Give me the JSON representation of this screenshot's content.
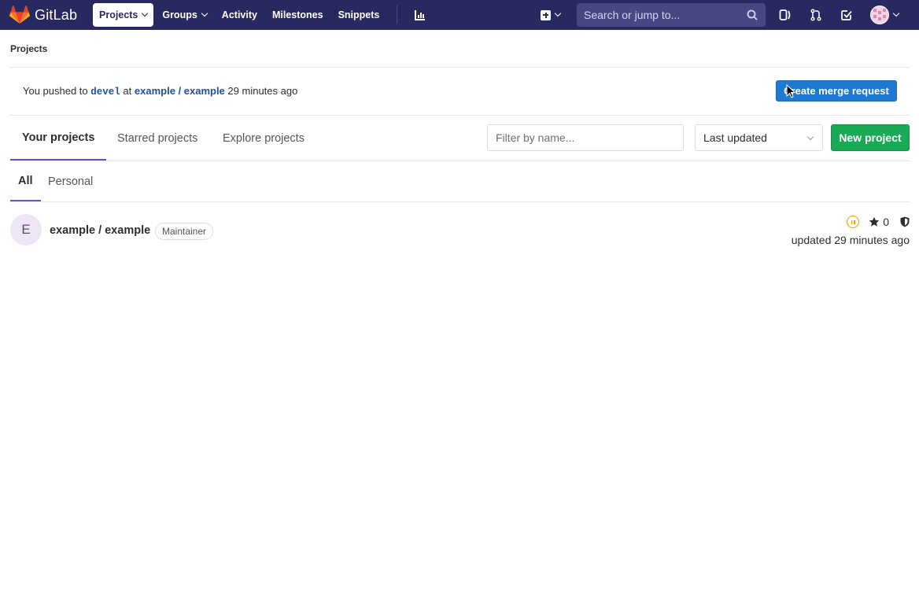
{
  "navbar": {
    "brand": "GitLab",
    "links": [
      {
        "label": "Projects",
        "active": true,
        "dropdown": true
      },
      {
        "label": "Groups",
        "active": false,
        "dropdown": true
      },
      {
        "label": "Activity",
        "active": false,
        "dropdown": false
      },
      {
        "label": "Milestones",
        "active": false,
        "dropdown": false
      },
      {
        "label": "Snippets",
        "active": false,
        "dropdown": false
      }
    ],
    "search_placeholder": "Search or jump to...",
    "background": "#292961"
  },
  "breadcrumb": {
    "label": "Projects"
  },
  "push_event": {
    "prefix": "You pushed to",
    "branch": "devel",
    "at_word": "at",
    "project": "example / example",
    "time": "29 minutes ago",
    "button_label": "Create merge request"
  },
  "tabs": {
    "your_projects": "Your projects",
    "starred_projects": "Starred projects",
    "explore_projects": "Explore projects",
    "active": "Your projects"
  },
  "filter": {
    "placeholder": "Filter by name..."
  },
  "sort": {
    "selected": "Last updated"
  },
  "new_project_label": "New project",
  "subtabs": {
    "all": "All",
    "personal": "Personal",
    "active": "All"
  },
  "projects": [
    {
      "avatar_letter": "E",
      "name": "example / example",
      "role": "Maintainer",
      "stars": "0",
      "updated": "updated 29 minutes ago",
      "pipeline_status": "paused"
    }
  ],
  "colors": {
    "accent_tab": "#6b4fbb",
    "primary_button": "#1f78d1",
    "success_button": "#1aaa55",
    "pipeline_status": "#fc9403",
    "link": "#1f4fa8"
  }
}
